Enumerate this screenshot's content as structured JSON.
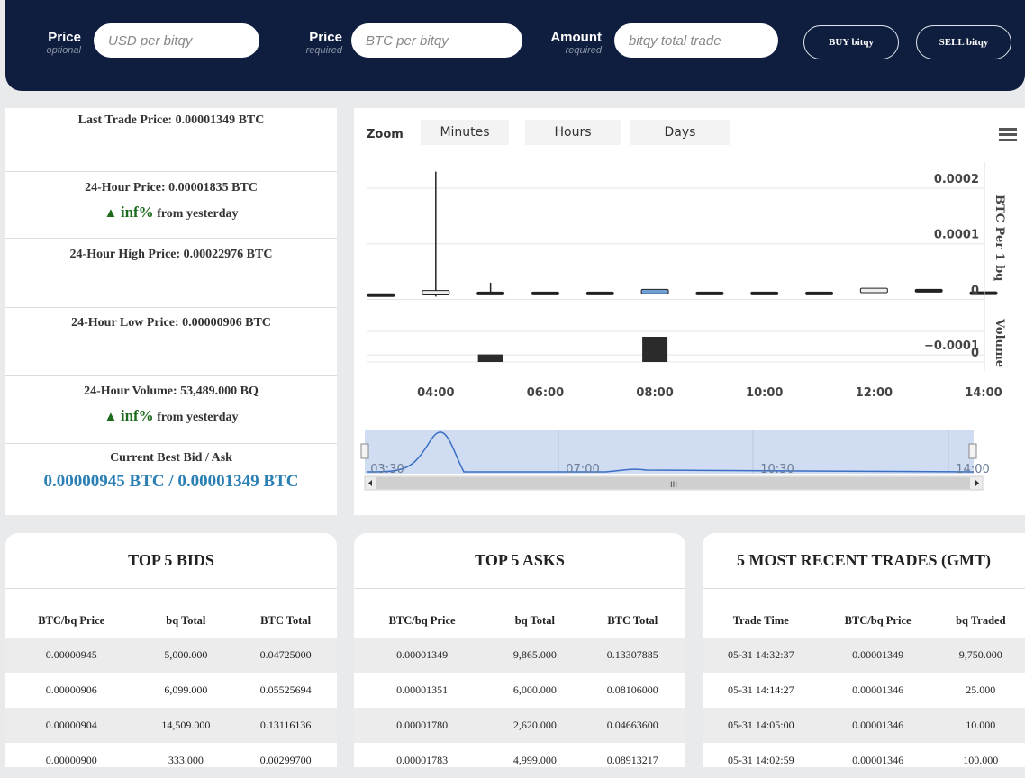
{
  "order_form": {
    "price_usd": {
      "label": "Price",
      "sub": "optional",
      "placeholder": "USD per bitqy"
    },
    "price_btc": {
      "label": "Price",
      "sub": "required",
      "placeholder": "BTC per bitqy"
    },
    "amount": {
      "label": "Amount",
      "sub": "required",
      "placeholder": "bitqy total trade"
    },
    "buy_label": "BUY bitqy",
    "sell_label": "SELL bitqy"
  },
  "stats": {
    "last_trade": "Last Trade Price: 0.00001349 BTC",
    "price_24h": "24-Hour Price: 0.00001835 BTC",
    "price_change_arrow": "▲",
    "price_change": "inf%",
    "price_change_suffix": "from yesterday",
    "high_24h": "24-Hour High Price: 0.00022976 BTC",
    "low_24h": "24-Hour Low Price: 0.00000906 BTC",
    "volume_24h": "24-Hour Volume: 53,489.000 BQ",
    "volume_change_arrow": "▲",
    "volume_change": "inf%",
    "volume_change_suffix": "from yesterday",
    "best_bid_ask_label": "Current Best Bid / Ask",
    "best_bid_ask_value": "0.00000945 BTC / 0.00001349 BTC",
    "colors": {
      "up": "#1e6b1e",
      "bid_ask": "#2a7fb5"
    }
  },
  "chart_controls": {
    "zoom_label": "Zoom",
    "buttons": [
      "Minutes",
      "Hours",
      "Days"
    ],
    "menu_icon": "hamburger-menu-icon"
  },
  "chart_data": {
    "type": "candlestick",
    "x": [
      "03:00",
      "04:00",
      "05:00",
      "06:00",
      "07:00",
      "08:00",
      "09:00",
      "10:00",
      "11:00",
      "12:00",
      "13:00",
      "14:00"
    ],
    "x_ticks": [
      "04:00",
      "06:00",
      "08:00",
      "10:00",
      "12:00",
      "14:00"
    ],
    "price_axis": {
      "label": "BTC Per 1 bq",
      "ticks": [
        "0.0002",
        "0.0001",
        "0",
        "−0.0001"
      ],
      "ylim": [
        -0.00015,
        0.00026
      ]
    },
    "volume_axis": {
      "label": "Volume",
      "ticks": [
        "0"
      ]
    },
    "candles": [
      {
        "t": "03:00",
        "open": 1e-05,
        "close": 1e-05,
        "high": 1e-05,
        "low": 1e-05,
        "up": false
      },
      {
        "t": "04:00",
        "open": 8e-06,
        "close": 1.6e-05,
        "high": 0.00022976,
        "low": 5e-06,
        "up": true
      },
      {
        "t": "05:00",
        "open": 1.3e-05,
        "close": 1.3e-05,
        "high": 3e-05,
        "low": 1.2e-05,
        "up": false
      },
      {
        "t": "06:00",
        "open": 1.3e-05,
        "close": 1.3e-05,
        "high": 1.3e-05,
        "low": 1.3e-05,
        "up": false
      },
      {
        "t": "07:00",
        "open": 1.3e-05,
        "close": 1.3e-05,
        "high": 1.3e-05,
        "low": 1.3e-05,
        "up": false
      },
      {
        "t": "08:00",
        "open": 1e-05,
        "close": 1.8e-05,
        "high": 1.8e-05,
        "low": 1e-05,
        "up": true,
        "highlight": true
      },
      {
        "t": "09:00",
        "open": 1.3e-05,
        "close": 1.3e-05,
        "high": 1.3e-05,
        "low": 1.3e-05,
        "up": false
      },
      {
        "t": "10:00",
        "open": 1.3e-05,
        "close": 1.3e-05,
        "high": 1.3e-05,
        "low": 1.3e-05,
        "up": false
      },
      {
        "t": "11:00",
        "open": 1.3e-05,
        "close": 1.3e-05,
        "high": 1.3e-05,
        "low": 1.3e-05,
        "up": false
      },
      {
        "t": "12:00",
        "open": 1.2e-05,
        "close": 2e-05,
        "high": 2e-05,
        "low": 1.2e-05,
        "up": true
      },
      {
        "t": "13:00",
        "open": 1.8e-05,
        "close": 1.8e-05,
        "high": 1.8e-05,
        "low": 1.8e-05,
        "up": false
      },
      {
        "t": "14:00",
        "open": 1.34e-05,
        "close": 1.34e-05,
        "high": 1.34e-05,
        "low": 1.34e-05,
        "up": false
      }
    ],
    "volume": [
      {
        "t": "05:00",
        "value": 0.3
      },
      {
        "t": "08:00",
        "value": 1.0
      }
    ],
    "navigator": {
      "ticks": [
        "03:30",
        "07:00",
        "10:30",
        "14:00"
      ]
    }
  },
  "bids": {
    "title": "TOP 5 BIDS",
    "columns": [
      "BTC/bq Price",
      "bq Total",
      "BTC Total"
    ],
    "rows": [
      [
        "0.00000945",
        "5,000.000",
        "0.04725000"
      ],
      [
        "0.00000906",
        "6,099.000",
        "0.05525694"
      ],
      [
        "0.00000904",
        "14,509.000",
        "0.13116136"
      ],
      [
        "0.00000900",
        "333.000",
        "0.00299700"
      ]
    ]
  },
  "asks": {
    "title": "TOP 5 ASKS",
    "columns": [
      "BTC/bq Price",
      "bq Total",
      "BTC Total"
    ],
    "rows": [
      [
        "0.00001349",
        "9,865.000",
        "0.13307885"
      ],
      [
        "0.00001351",
        "6,000.000",
        "0.08106000"
      ],
      [
        "0.00001780",
        "2,620.000",
        "0.04663600"
      ],
      [
        "0.00001783",
        "4,999.000",
        "0.08913217"
      ]
    ]
  },
  "trades": {
    "title": "5 MOST RECENT TRADES (GMT)",
    "columns": [
      "Trade Time",
      "BTC/bq Price",
      "bq Traded"
    ],
    "rows": [
      [
        "05-31 14:32:37",
        "0.00001349",
        "9,750.000"
      ],
      [
        "05-31 14:14:27",
        "0.00001346",
        "25.000"
      ],
      [
        "05-31 14:05:00",
        "0.00001346",
        "10.000"
      ],
      [
        "05-31 14:02:59",
        "0.00001346",
        "100.000"
      ]
    ]
  }
}
